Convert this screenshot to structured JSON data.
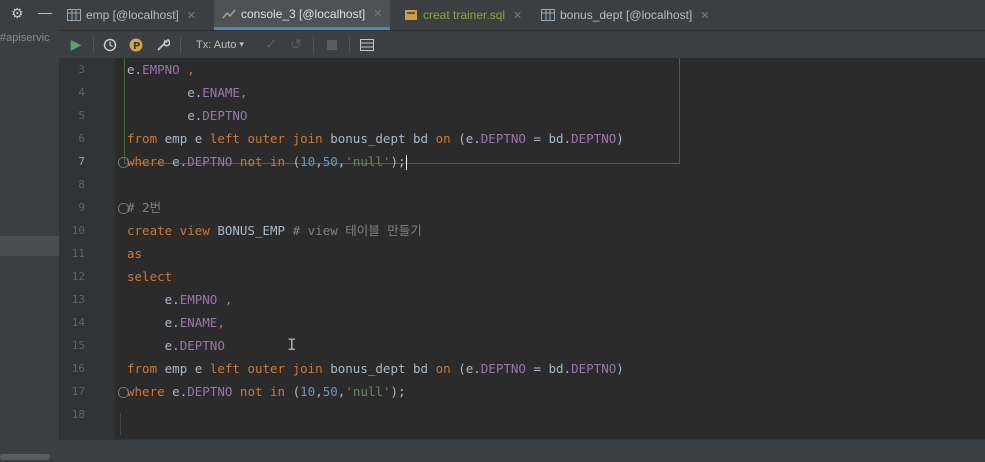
{
  "left_panel": {
    "project_label": "#apiservic",
    "gear_icon": "gear-icon",
    "minimize_icon": "minimize-icon"
  },
  "tabs": [
    {
      "label": "emp [@localhost]",
      "icon": "table-icon",
      "active": false
    },
    {
      "label": "console_3 [@localhost]",
      "icon": "console-icon",
      "active": true
    },
    {
      "label": "creat trainer.sql",
      "icon": "sql-file-icon",
      "active": false
    },
    {
      "label": "bonus_dept [@localhost]",
      "icon": "table-icon",
      "active": false
    }
  ],
  "toolbar": {
    "tx_mode": "Tx: Auto",
    "icons": [
      "run-icon",
      "history-icon",
      "p-badge-icon",
      "wrench-icon",
      "commit-check-icon",
      "rollback-icon",
      "stop-icon",
      "grid-icon"
    ]
  },
  "editor": {
    "lines": [
      {
        "n": "3",
        "t": "e.EMPNO ,"
      },
      {
        "n": "4",
        "t": "e.ENAME,"
      },
      {
        "n": "5",
        "t": "e.DEPTNO"
      },
      {
        "n": "6",
        "t": "from emp e left outer join bonus_dept bd on (e.DEPTNO = bd.DEPTNO)"
      },
      {
        "n": "7",
        "t": "where e.DEPTNO not in (10,50,'null');"
      },
      {
        "n": "8",
        "t": ""
      },
      {
        "n": "9",
        "t": "# 2번"
      },
      {
        "n": "10",
        "t": "create view BONUS_EMP # view 테이블 만들기"
      },
      {
        "n": "11",
        "t": "as"
      },
      {
        "n": "12",
        "t": "select"
      },
      {
        "n": "13",
        "t": "e.EMPNO ,"
      },
      {
        "n": "14",
        "t": "e.ENAME,"
      },
      {
        "n": "15",
        "t": "e.DEPTNO"
      },
      {
        "n": "16",
        "t": "from emp e left outer join bonus_dept bd on (e.DEPTNO = bd.DEPTNO)"
      },
      {
        "n": "17",
        "t": "where e.DEPTNO not in (10,50,'null');"
      },
      {
        "n": "18",
        "t": ""
      }
    ],
    "current_line": "7",
    "colors": {
      "keyword": "#cc7832",
      "field": "#9876aa",
      "string": "#6a8759",
      "number": "#6897bb",
      "comment": "#808080"
    }
  }
}
